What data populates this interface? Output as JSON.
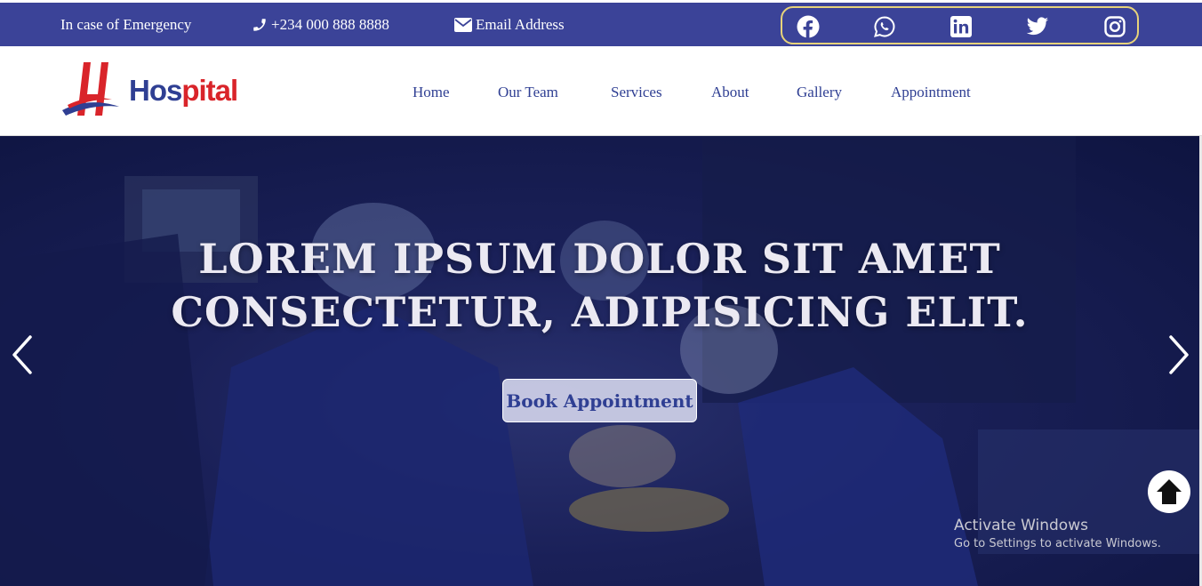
{
  "topbar": {
    "emergency": "In case of Emergency",
    "phone": "+234 000 888 8888",
    "email": "Email Address",
    "phone_icon": "phone-icon",
    "email_icon": "envelope-icon",
    "social_icons": [
      "facebook-icon",
      "whatsapp-icon",
      "linkedin-icon",
      "twitter-icon",
      "instagram-icon"
    ],
    "background": "#3b4398",
    "social_border": "#e7d37a"
  },
  "brand": {
    "letter": "H",
    "name_part1": "Hos",
    "name_part2": "pital",
    "primary_color": "#2f3f93",
    "accent_color": "#d9242a"
  },
  "nav": {
    "items": [
      "Home",
      "Our Team",
      "Services",
      "About",
      "Gallery",
      "Appointment"
    ]
  },
  "hero": {
    "title_line1": "LOREM IPSUM DOLOR SIT AMET",
    "title_line2": "CONSECTETUR, ADIPISICING ELIT.",
    "cta": "Book Appointment",
    "prev_icon": "chevron-left-icon",
    "next_icon": "chevron-right-icon",
    "to_top_icon": "arrow-up-icon"
  },
  "watermark": {
    "title": "Activate Windows",
    "subtitle": "Go to Settings to activate Windows."
  }
}
